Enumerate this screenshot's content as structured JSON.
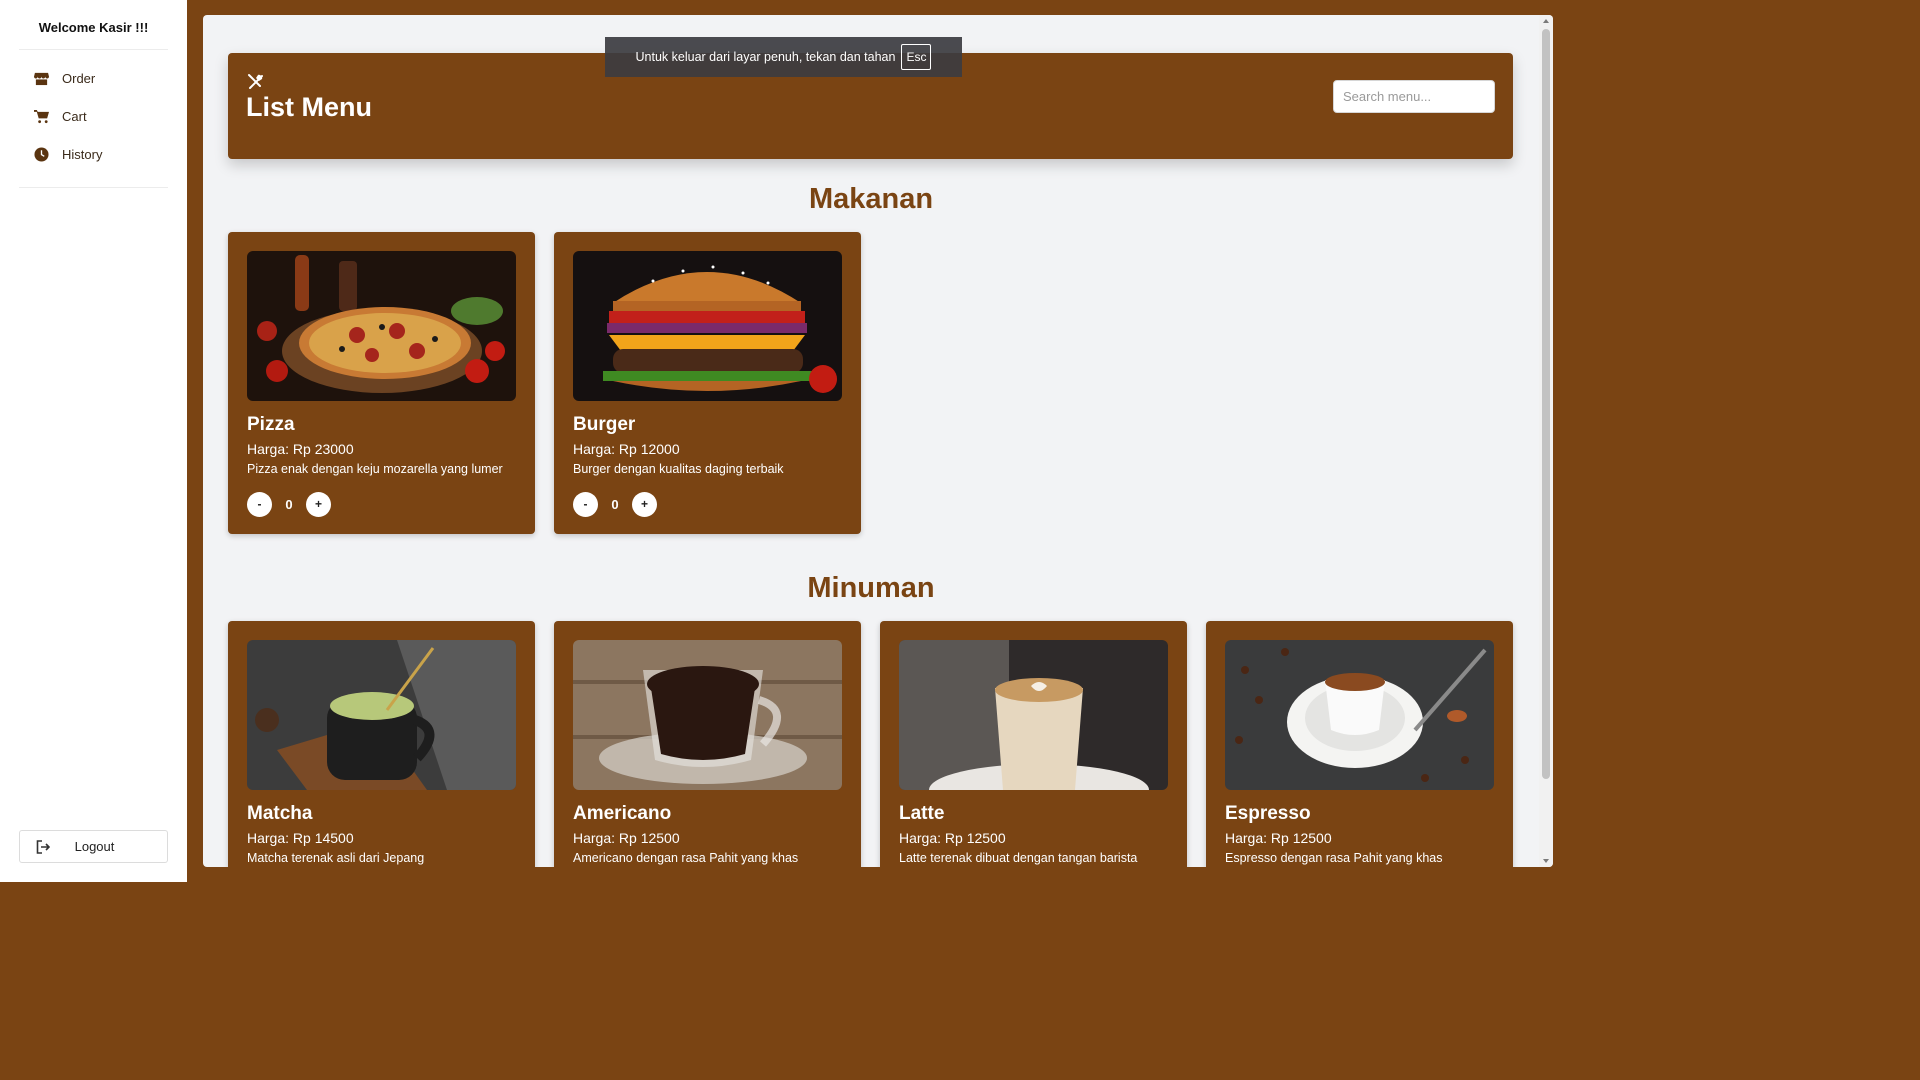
{
  "sidebar": {
    "welcome": "Welcome Kasir !!!",
    "items": [
      {
        "label": "Order",
        "icon": "store-icon"
      },
      {
        "label": "Cart",
        "icon": "cart-icon"
      },
      {
        "label": "History",
        "icon": "clock-icon"
      }
    ],
    "logout_label": "Logout"
  },
  "header": {
    "title": "List Menu",
    "icon": "utensils-icon",
    "search_placeholder": "Search menu..."
  },
  "toast": {
    "text": "Untuk keluar dari layar penuh, tekan dan tahan",
    "key": "Esc"
  },
  "sections": [
    {
      "title": "Makanan",
      "items": [
        {
          "name": "Pizza",
          "price": "Harga: Rp 23000",
          "desc": "Pizza enak dengan keju mozarella yang lumer",
          "qty": "0",
          "minus": "-",
          "plus": "+"
        },
        {
          "name": "Burger",
          "price": "Harga: Rp 12000",
          "desc": "Burger dengan kualitas daging terbaik",
          "qty": "0",
          "minus": "-",
          "plus": "+"
        }
      ]
    },
    {
      "title": "Minuman",
      "items": [
        {
          "name": "Matcha",
          "price": "Harga: Rp 14500",
          "desc": "Matcha terenak asli dari Jepang"
        },
        {
          "name": "Americano",
          "price": "Harga: Rp 12500",
          "desc": "Americano dengan rasa Pahit yang khas"
        },
        {
          "name": "Latte",
          "price": "Harga: Rp 12500",
          "desc": "Latte terenak dibuat dengan tangan barista"
        },
        {
          "name": "Espresso",
          "price": "Harga: Rp 12500",
          "desc": "Espresso dengan rasa Pahit yang khas"
        }
      ]
    }
  ],
  "colors": {
    "brand_brown": "#7a4413",
    "panel_bg": "#f2f3f5"
  }
}
